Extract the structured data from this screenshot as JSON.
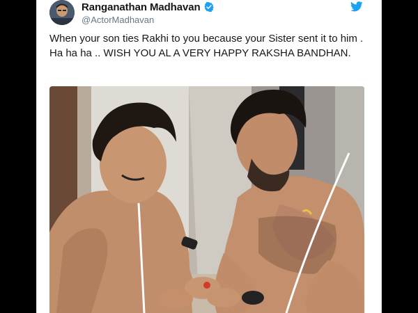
{
  "tweet": {
    "display_name": "Ranganathan Madhavan",
    "handle": "@ActorMadhavan",
    "text": "When your son ties Rakhi to you because your Sister sent it to him . Ha ha ha .. WISH YOU AL A VERY HAPPY RAKSHA BANDHAN.",
    "verified": true
  },
  "icons": {
    "verified": "verified-badge-icon",
    "brand": "twitter-bird-icon"
  },
  "colors": {
    "name": "#14171a",
    "handle": "#657786",
    "verified": "#1da1f2",
    "brand": "#1da1f2",
    "background": "#000000"
  }
}
